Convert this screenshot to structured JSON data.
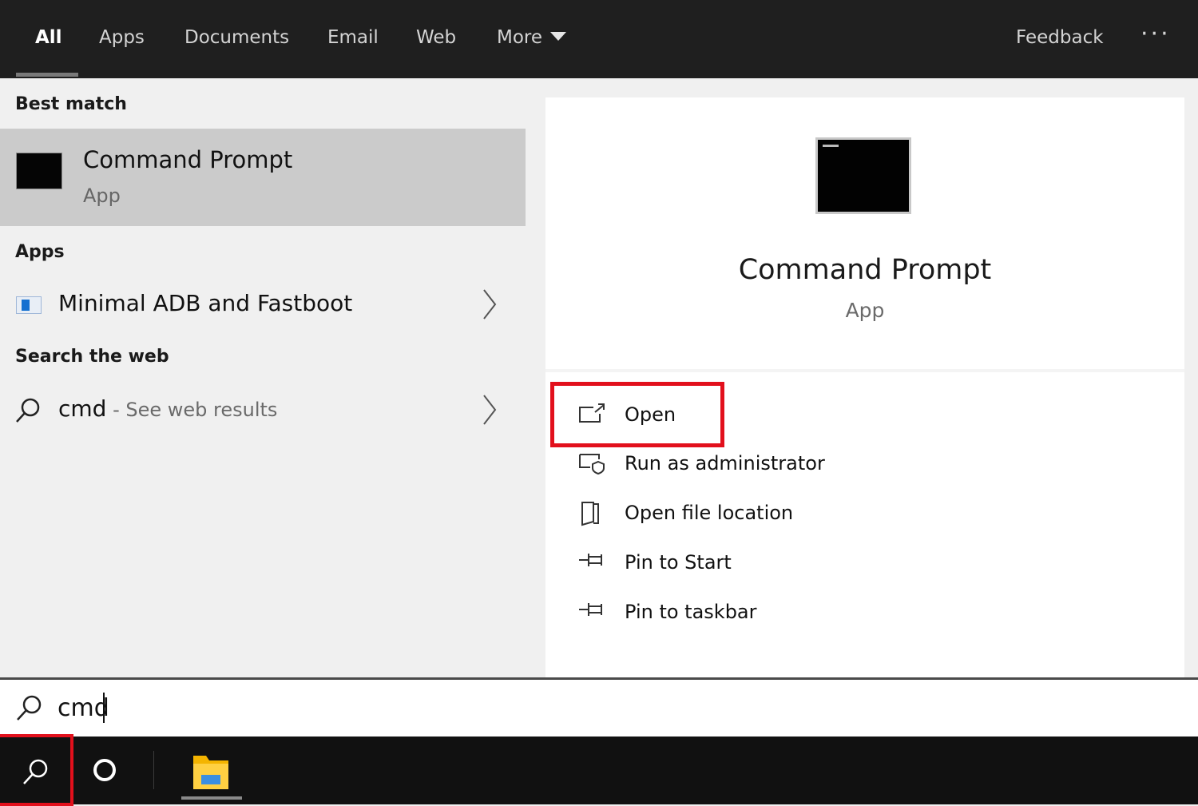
{
  "topbar": {
    "tabs": [
      {
        "label": "All",
        "active": true
      },
      {
        "label": "Apps"
      },
      {
        "label": "Documents"
      },
      {
        "label": "Email"
      },
      {
        "label": "Web"
      },
      {
        "label": "More"
      }
    ],
    "feedback_label": "Feedback",
    "more_options_label": "···"
  },
  "left": {
    "best_match_title": "Best match",
    "best_match": {
      "name": "Command Prompt",
      "type": "App",
      "icon": "command-prompt-icon"
    },
    "apps_title": "Apps",
    "apps": [
      {
        "label": "Minimal ADB and Fastboot",
        "icon": "adb-app-icon"
      }
    ],
    "web_title": "Search the web",
    "web_result": {
      "query": "cmd",
      "suffix": " - See web results"
    }
  },
  "detail": {
    "title": "Command Prompt",
    "type": "App",
    "actions": [
      {
        "label": "Open",
        "icon": "open-icon"
      },
      {
        "label": "Run as administrator",
        "icon": "run-as-admin-icon"
      },
      {
        "label": "Open file location",
        "icon": "file-location-icon"
      },
      {
        "label": "Pin to Start",
        "icon": "pin-icon"
      },
      {
        "label": "Pin to taskbar",
        "icon": "pin-icon"
      }
    ]
  },
  "search": {
    "value": "cmd"
  },
  "colors": {
    "highlight": "#e2101c",
    "topbar": "#1f1f1f",
    "selected_row": "#cbcbcb"
  }
}
